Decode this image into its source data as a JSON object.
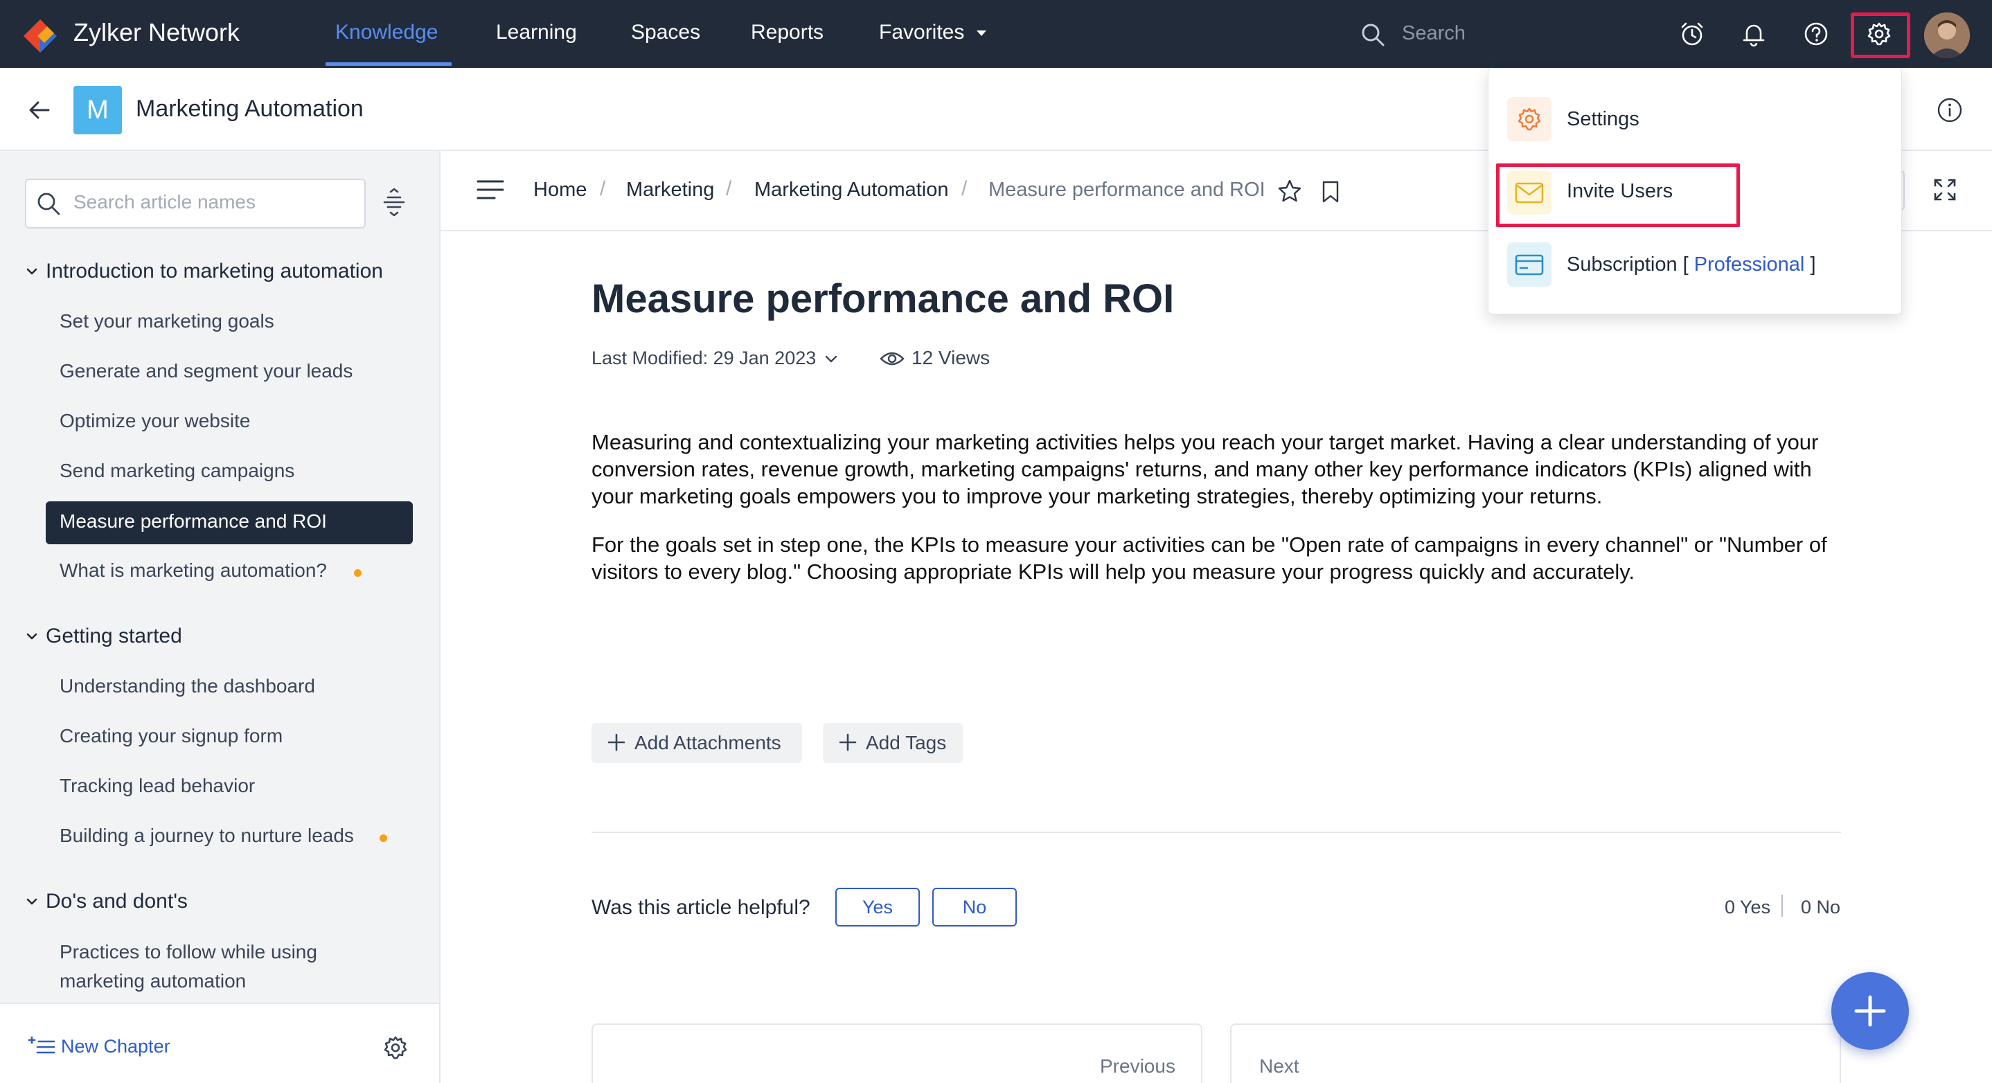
{
  "app": {
    "name": "Zylker Network",
    "nav": [
      "Knowledge",
      "Learning",
      "Spaces",
      "Reports",
      "Favorites"
    ],
    "active_nav": "Knowledge",
    "search_placeholder": "Search",
    "top_icons": [
      "alarm-clock-icon",
      "bell-icon",
      "help-icon",
      "gear-icon",
      "avatar"
    ]
  },
  "space": {
    "badge": "M",
    "title": "Marketing Automation",
    "badge_color": "#4cb6ec"
  },
  "sidebar": {
    "search_placeholder": "Search article names",
    "sections": [
      {
        "title": "Introduction to marketing automation",
        "items": [
          "Set your marketing goals",
          "Generate and segment your leads",
          "Optimize your website",
          "Send marketing campaigns",
          "Measure performance and ROI",
          "What is marketing automation?"
        ]
      },
      {
        "title": "Getting started",
        "items": [
          "Understanding the dashboard",
          "Creating your signup form",
          "Tracking lead behavior",
          "Building a journey to nurture leads"
        ]
      },
      {
        "title": "Do's and dont's",
        "items": [
          "Practices to follow while using marketing automation"
        ]
      }
    ],
    "active_item": "Measure performance and ROI",
    "new_chapter": "New Chapter"
  },
  "breadcrumb": [
    "Home",
    "Marketing",
    "Marketing Automation",
    "Measure performance and ROI"
  ],
  "article": {
    "title": "Measure performance and ROI",
    "last_modified_label": "Last Modified:",
    "last_modified_date": "29 Jan 2023",
    "views": "12 Views",
    "paragraphs": [
      "Measuring and contextualizing your marketing activities helps you reach your target market. Having a clear understanding of your conversion rates, revenue growth, marketing campaigns' returns, and many other key performance indicators (KPIs) aligned with your marketing goals empowers you to improve your marketing strategies, thereby optimizing your returns.",
      "For the goals set in step one, the KPIs to measure your activities can be \"Open rate of campaigns in every channel\" or \"Number of visitors to every blog.\" Choosing appropriate KPIs will help you measure your progress quickly and accurately."
    ],
    "add_attachments": "Add Attachments",
    "add_tags": "Add Tags",
    "helpful_question": "Was this article helpful?",
    "yes": "Yes",
    "no": "No",
    "yes_count": "0 Yes",
    "no_count": "0 No",
    "previous": "Previous",
    "next": "Next"
  },
  "dropdown": {
    "settings": "Settings",
    "invite_users": "Invite Users",
    "subscription": "Subscription",
    "subscription_open": "[",
    "plan": "Professional",
    "subscription_close": "]"
  },
  "colors": {
    "nav_bg": "#212b3a",
    "accent": "#2e5bc9",
    "active_nav": "#5b8def",
    "highlight": "#e8194b",
    "dot": "#f6a019"
  }
}
